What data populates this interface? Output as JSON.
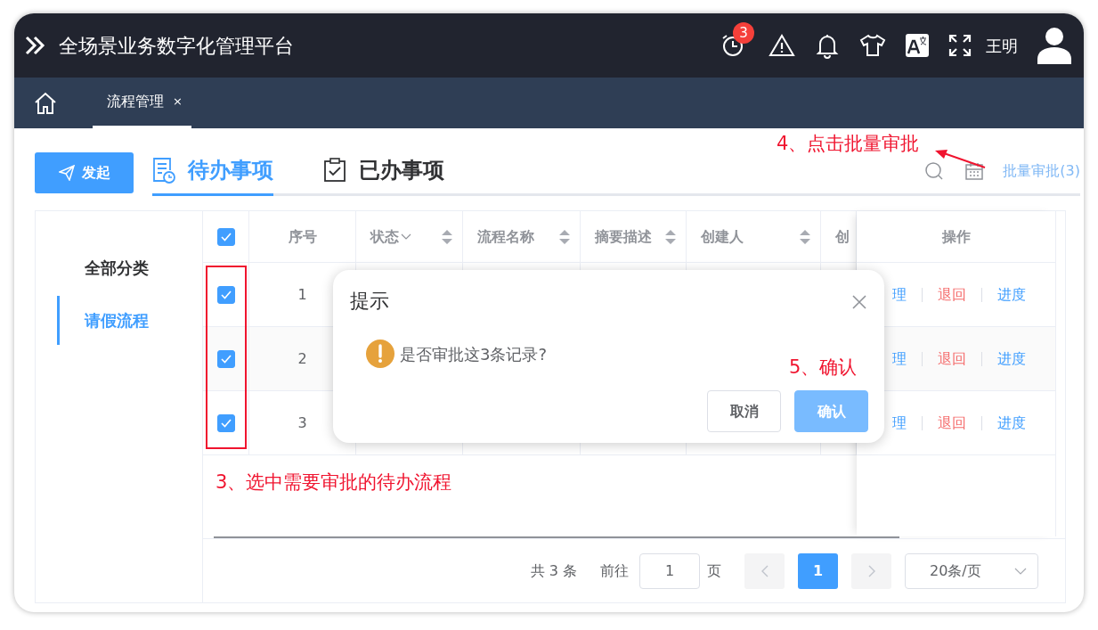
{
  "header": {
    "title": "全场景业务数字化管理平台",
    "alarm_badge": "3",
    "user": "王明"
  },
  "tabs": [
    {
      "label": "流程管理",
      "selected": true,
      "close": "×"
    }
  ],
  "toolbar": {
    "launch_button": "发起",
    "views": [
      {
        "label": "待办事项",
        "selected": true
      },
      {
        "label": "已办事项",
        "selected": false
      }
    ],
    "batch_link": "批量审批(3)"
  },
  "categories": [
    {
      "label": "全部分类",
      "selected": false
    },
    {
      "label": "请假流程",
      "selected": true
    }
  ],
  "table": {
    "select_all_checked": true,
    "columns": [
      {
        "label": "序号",
        "sortable": false,
        "filter": false
      },
      {
        "label": "状态",
        "sortable": true,
        "filter": true
      },
      {
        "label": "流程名称",
        "sortable": true,
        "filter": false
      },
      {
        "label": "摘要描述",
        "sortable": true,
        "filter": false
      },
      {
        "label": "创建人",
        "sortable": true,
        "filter": false
      },
      {
        "label": "创",
        "sortable": false,
        "filter": false
      }
    ],
    "actions_column": "操作",
    "rows": [
      {
        "checked": true,
        "index": "1",
        "actions": [
          {
            "label": "理",
            "kind": "primary"
          },
          {
            "label": "退回",
            "kind": "danger"
          },
          {
            "label": "进度",
            "kind": "primary"
          }
        ]
      },
      {
        "checked": true,
        "index": "2",
        "actions": [
          {
            "label": "理",
            "kind": "primary"
          },
          {
            "label": "退回",
            "kind": "danger"
          },
          {
            "label": "进度",
            "kind": "primary"
          }
        ]
      },
      {
        "checked": true,
        "index": "3",
        "actions": [
          {
            "label": "理",
            "kind": "primary"
          },
          {
            "label": "退回",
            "kind": "danger"
          },
          {
            "label": "进度",
            "kind": "primary"
          }
        ]
      }
    ]
  },
  "pagination": {
    "total": "共 3 条",
    "goto_label": "前往",
    "goto_value": "1",
    "page_unit": "页",
    "pages": [
      {
        "label": "1",
        "selected": true
      }
    ],
    "page_size": "20条/页"
  },
  "dialog": {
    "title": "提示",
    "message": "是否审批这3条记录?",
    "buttons": [
      {
        "label": "取消",
        "kind": "default"
      },
      {
        "label": "确认",
        "kind": "primary"
      }
    ]
  },
  "annotations": [
    {
      "text": "4、点击批量审批"
    },
    {
      "text": "5、确认"
    },
    {
      "text": "3、选中需要审批的待办流程"
    }
  ]
}
